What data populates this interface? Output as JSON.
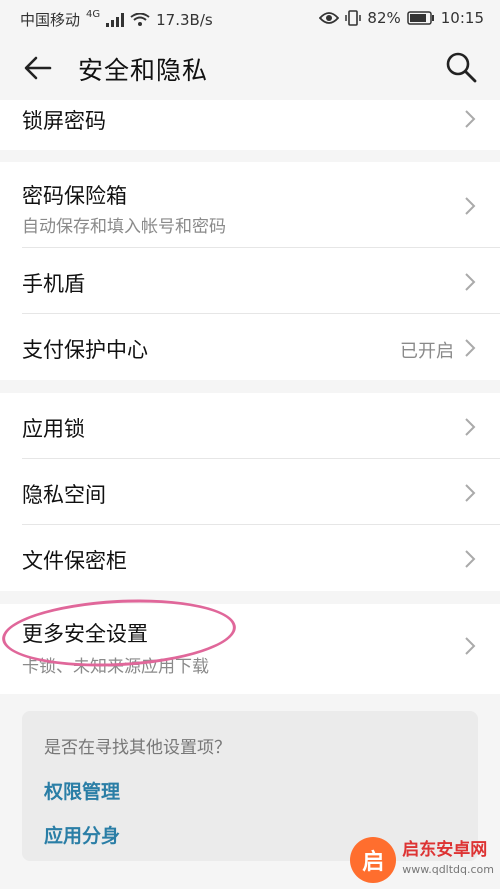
{
  "status_bar": {
    "carrier": "中国移动",
    "net_type": "4G",
    "speed": "17.3B/s",
    "battery": "82%",
    "time": "10:15"
  },
  "app_bar": {
    "title": "安全和隐私",
    "back_icon": "arrow-left",
    "search_icon": "magnifier"
  },
  "groups": [
    {
      "items": [
        {
          "label": "锁屏密码"
        }
      ]
    },
    {
      "items": [
        {
          "label": "密码保险箱",
          "sub": "自动保存和填入帐号和密码"
        },
        {
          "label": "手机盾"
        },
        {
          "label": "支付保护中心",
          "status": "已开启"
        }
      ]
    },
    {
      "items": [
        {
          "label": "应用锁"
        },
        {
          "label": "隐私空间"
        },
        {
          "label": "文件保密柜"
        }
      ]
    },
    {
      "items": [
        {
          "label": "更多安全设置",
          "sub": "卡锁、未知来源应用下载"
        }
      ]
    }
  ],
  "suggest": {
    "question": "是否在寻找其他设置项？",
    "links": [
      "权限管理",
      "应用分身"
    ]
  },
  "watermark": {
    "name": "启东安卓网",
    "url": "www.qdltdq.com"
  },
  "colors": {
    "background": "#f5f5f5",
    "link": "#2a7ea6",
    "highlight": "#e0679a"
  }
}
